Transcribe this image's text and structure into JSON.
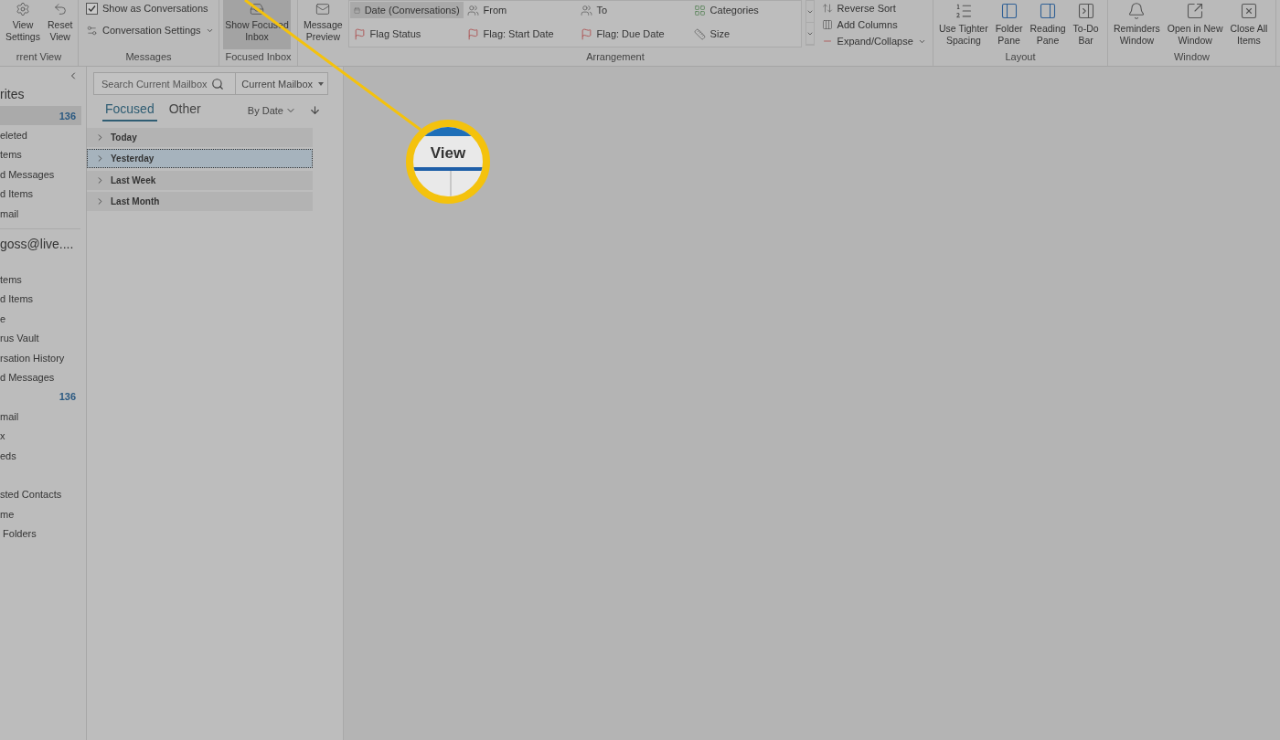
{
  "ribbon": {
    "current_view": {
      "label": "rrent View",
      "buttons": [
        {
          "label": "View Settings"
        },
        {
          "label": "Reset View"
        }
      ]
    },
    "messages": {
      "label": "Messages",
      "show_as_conversations": {
        "label": "Show as Conversations",
        "checked": true
      },
      "conversation_settings": "Conversation Settings"
    },
    "focused_inbox": {
      "label": "Focused Inbox",
      "button": {
        "label": "Show Focused Inbox",
        "selected": true
      }
    },
    "arrangement": {
      "label": "Arrangement",
      "message_preview": "Message Preview",
      "items": [
        {
          "label": "Date (Conversations)",
          "selected": true,
          "kind": "date"
        },
        {
          "label": "From",
          "selected": false,
          "kind": "person"
        },
        {
          "label": "To",
          "selected": false,
          "kind": "person"
        },
        {
          "label": "Categories",
          "selected": false,
          "kind": "categories"
        },
        {
          "label": "Flag Status",
          "selected": false,
          "kind": "flag"
        },
        {
          "label": "Flag: Start Date",
          "selected": false,
          "kind": "flag"
        },
        {
          "label": "Flag: Due Date",
          "selected": false,
          "kind": "flag"
        },
        {
          "label": "Size",
          "selected": false,
          "kind": "size"
        }
      ],
      "side": [
        {
          "label": "Reverse Sort",
          "kind": "sort"
        },
        {
          "label": "Add Columns",
          "kind": "columns"
        },
        {
          "label": "Expand/Collapse",
          "kind": "expand"
        }
      ]
    },
    "layout": {
      "label": "Layout",
      "buttons": [
        {
          "label": "Use Tighter Spacing",
          "kind": "spacing"
        },
        {
          "label": "Folder Pane",
          "kind": "folder"
        },
        {
          "label": "Reading Pane",
          "kind": "reading"
        },
        {
          "label": "To-Do Bar",
          "kind": "todo"
        }
      ]
    },
    "window": {
      "label": "Window",
      "buttons": [
        {
          "label": "Reminders Window",
          "kind": "bell"
        },
        {
          "label": "Open in New Window",
          "kind": "window"
        },
        {
          "label": "Close All Items",
          "kind": "close"
        }
      ]
    }
  },
  "folder_pane": {
    "favorites": "rites",
    "favorite_items": [
      {
        "count": "136",
        "selected": true
      },
      {
        "label": "eleted",
        "selected": false
      },
      {
        "label": "tems",
        "selected": false
      },
      {
        "label": "d Messages",
        "selected": false
      },
      {
        "label": "d Items",
        "selected": false
      },
      {
        "label": "mail",
        "selected": false
      }
    ],
    "account": "goss@live....",
    "account_items": [
      {
        "label": "tems"
      },
      {
        "label": "d Items"
      },
      {
        "label": "e"
      },
      {
        "label": "rus Vault"
      },
      {
        "label": "rsation History"
      },
      {
        "label": "d Messages"
      },
      {
        "count": "136"
      },
      {
        "label": "mail"
      },
      {
        "label": "x"
      },
      {
        "label": "eds"
      },
      {
        "label": "sted Contacts",
        "gap_before": true
      },
      {
        "label": "me"
      },
      {
        "label": " Folders"
      }
    ]
  },
  "message_list": {
    "search": {
      "placeholder": "Search Current Mailbox"
    },
    "scope": "Current Mailbox",
    "tabs": [
      {
        "label": "Focused",
        "selected": true
      },
      {
        "label": "Other",
        "selected": false
      }
    ],
    "sort": "By Date",
    "groups": [
      {
        "label": "Today",
        "selected": false
      },
      {
        "label": "Yesterday",
        "selected": true
      },
      {
        "label": "Last Week",
        "selected": false
      },
      {
        "label": "Last Month",
        "selected": false
      }
    ]
  },
  "callout": {
    "label": "View"
  }
}
